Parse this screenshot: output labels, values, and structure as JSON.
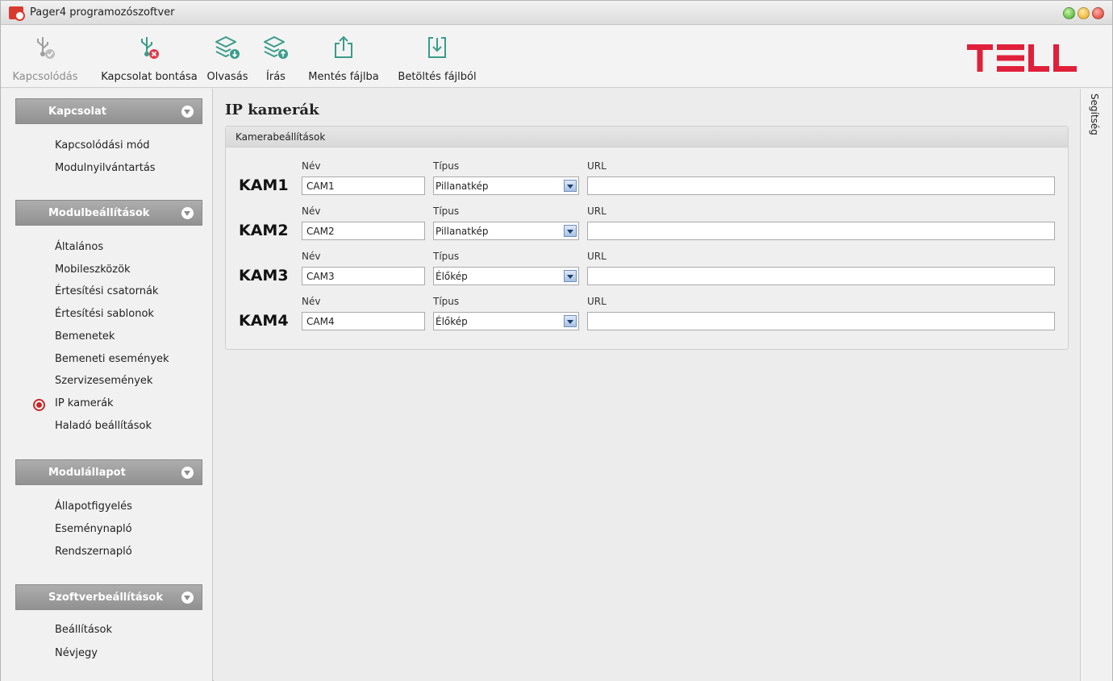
{
  "window": {
    "title": "Pager4 programozószoftver"
  },
  "toolbar": {
    "connect": "Kapcsolódás",
    "disconnect": "Kapcsolat bontása",
    "read": "Olvasás",
    "write": "Írás",
    "save_file": "Mentés fájlba",
    "load_file": "Betöltés fájlból"
  },
  "brand": {
    "accent": "#e0203a"
  },
  "sidebar": {
    "sections": [
      {
        "title": "Kapcsolat",
        "items": [
          "Kapcsolódási mód",
          "Modulnyilvántartás"
        ]
      },
      {
        "title": "Modulbeállítások",
        "items": [
          "Általános",
          "Mobileszközök",
          "Értesítési csatornák",
          "Értesítési sablonok",
          "Bemenetek",
          "Bemeneti események",
          "Szervizesemények",
          "IP kamerák",
          "Haladó beállítások"
        ]
      },
      {
        "title": "Modulállapot",
        "items": [
          "Állapotfigyelés",
          "Eseménynapló",
          "Rendszernapló"
        ]
      },
      {
        "title": "Szoftverbeállítások",
        "items": [
          "Beállítások",
          "Névjegy"
        ]
      }
    ],
    "active_item": "IP kamerák"
  },
  "main": {
    "title": "IP kamerák",
    "group_title": "Kamerabeállítások",
    "labels": {
      "name": "Név",
      "type": "Típus",
      "url": "URL"
    },
    "cameras": [
      {
        "id": "KAM1",
        "name": "CAM1",
        "type": "Pillanatkép",
        "url": ""
      },
      {
        "id": "KAM2",
        "name": "CAM2",
        "type": "Pillanatkép",
        "url": ""
      },
      {
        "id": "KAM3",
        "name": "CAM3",
        "type": "Élőkép",
        "url": ""
      },
      {
        "id": "KAM4",
        "name": "CAM4",
        "type": "Élőkép",
        "url": ""
      }
    ]
  },
  "help": {
    "label": "Segítség"
  }
}
